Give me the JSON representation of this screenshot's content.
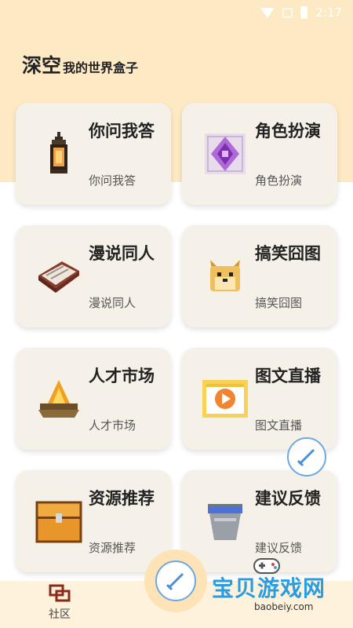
{
  "status_bar": {
    "time": "2:17"
  },
  "header": {
    "title": "深空",
    "subtitle": "我的世界盒子"
  },
  "cards": [
    {
      "title": "你问我答",
      "subtitle": "你问我答",
      "icon": "lantern-icon"
    },
    {
      "title": "角色扮演",
      "subtitle": "角色扮演",
      "icon": "ender-crystal-icon"
    },
    {
      "title": "漫说同人",
      "subtitle": "漫说同人",
      "icon": "book-icon"
    },
    {
      "title": "搞笑囧图",
      "subtitle": "搞笑囧图",
      "icon": "doge-icon"
    },
    {
      "title": "人才市场",
      "subtitle": "人才市场",
      "icon": "campfire-icon"
    },
    {
      "title": "图文直播",
      "subtitle": "图文直播",
      "icon": "video-play-icon"
    },
    {
      "title": "资源推荐",
      "subtitle": "资源推荐",
      "icon": "treasure-chest-icon"
    },
    {
      "title": "建议反馈",
      "subtitle": "建议反馈",
      "icon": "water-bucket-icon"
    }
  ],
  "tabbar": {
    "community_label": "社区"
  },
  "watermark": {
    "text": "宝贝游戏网",
    "url": "baobeiy.com"
  },
  "colors": {
    "header_bg": "#fde9c4",
    "card_bg": "#f6f1e8",
    "fab_border": "#6aa9e6",
    "watermark": "#2a9ce0"
  }
}
